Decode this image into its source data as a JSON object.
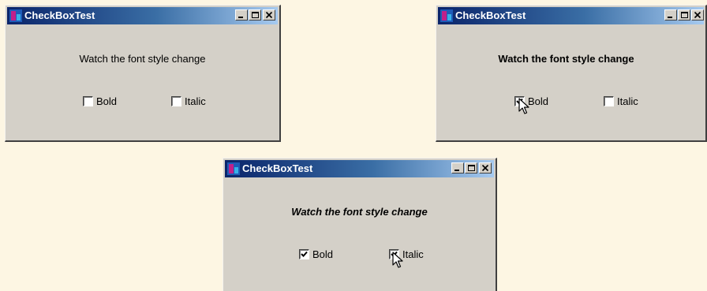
{
  "windows": [
    {
      "title": "CheckBoxTest",
      "label": "Watch the font style  change",
      "bold": {
        "label": "Bold",
        "checked": false
      },
      "italic": {
        "label": "Italic",
        "checked": false
      }
    },
    {
      "title": "CheckBoxTest",
      "label": "Watch the font style change",
      "bold": {
        "label": "Bold",
        "checked": true
      },
      "italic": {
        "label": "Italic",
        "checked": false
      }
    },
    {
      "title": "CheckBoxTest",
      "label": "Watch the font style change",
      "bold": {
        "label": "Bold",
        "checked": true
      },
      "italic": {
        "label": "Italic",
        "checked": true
      }
    }
  ],
  "colors": {
    "background": "#fdf6e3",
    "window_face": "#d4d0c8",
    "titlebar_start": "#0a246a",
    "titlebar_end": "#a6caf0"
  },
  "icons": [
    "app-icon",
    "minimize-icon",
    "maximize-icon",
    "close-icon",
    "checkmark-icon",
    "mouse-cursor-icon"
  ]
}
